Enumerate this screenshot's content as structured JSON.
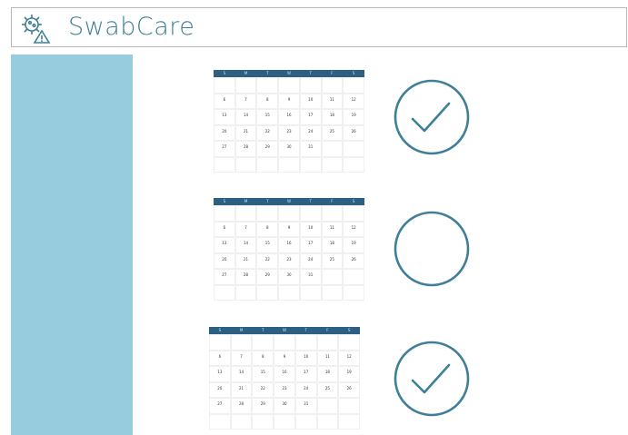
{
  "app": {
    "title": "SwabCare",
    "logo_icon": "virus-warning-icon",
    "accent_color": "#3f7f98",
    "sidebar_color": "#96ccde"
  },
  "calendar": {
    "weekdays": [
      "S",
      "M",
      "T",
      "W",
      "T",
      "F",
      "S"
    ],
    "weeks": [
      [
        "",
        "",
        "",
        "",
        "",
        "",
        ""
      ],
      [
        "6",
        "7",
        "8",
        "9",
        "10",
        "11",
        "12"
      ],
      [
        "13",
        "14",
        "15",
        "16",
        "17",
        "18",
        "19"
      ],
      [
        "20",
        "21",
        "22",
        "23",
        "24",
        "25",
        "26"
      ],
      [
        "27",
        "28",
        "29",
        "30",
        "31",
        "",
        ""
      ],
      [
        "",
        "",
        "",
        "",
        "",
        "",
        ""
      ]
    ]
  },
  "schedule": [
    {
      "status": "checked",
      "icon": "checkmark-circle-icon"
    },
    {
      "status": "unchecked",
      "icon": "empty-circle-icon"
    },
    {
      "status": "checked",
      "icon": "checkmark-circle-icon"
    }
  ]
}
